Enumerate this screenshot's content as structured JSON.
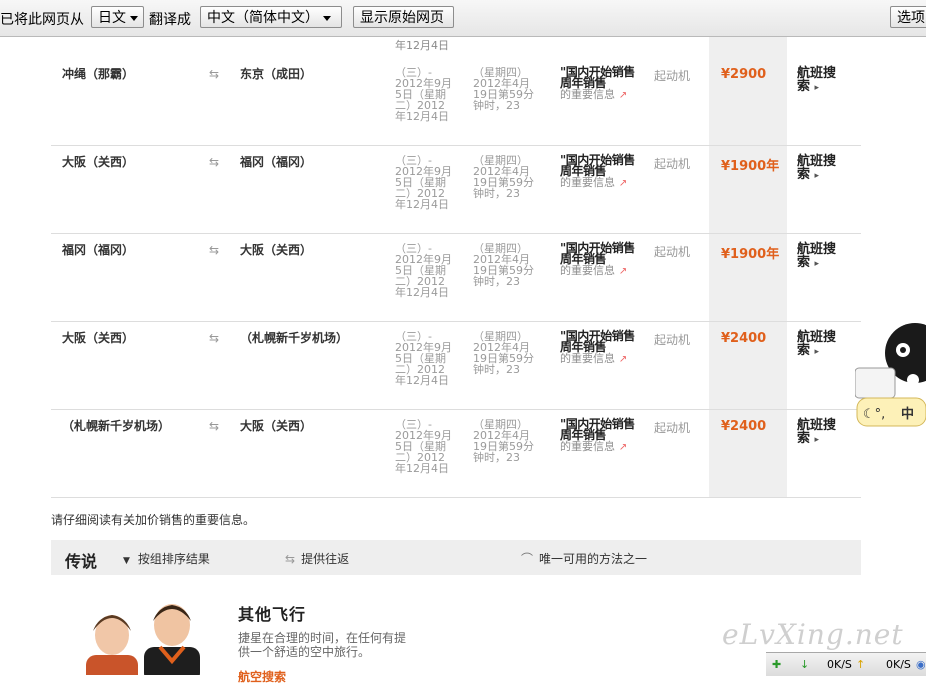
{
  "translate_bar": {
    "prefix": "已将此网页从",
    "source_lang": "日文",
    "translate_to": "翻译成",
    "target_lang": "中文（简体中文）",
    "show_original": "显示原始网页",
    "options": "选项"
  },
  "top_fragment": "年12月4日",
  "flights": [
    {
      "from": "冲绳（那霸）",
      "to": "东京（成田）",
      "date_from": "（三）- 2012年9月5日（星期二）2012年12月4日",
      "date_to": "（星期四）2012年4月19日第59分钟时，23",
      "sale_title": "\"国内开始销售周年销售",
      "sale_info": "的重要信息",
      "engine": "起动机",
      "price": "¥2900",
      "search": "航班搜索"
    },
    {
      "from": "大阪（关西）",
      "to": "福冈（福冈）",
      "date_from": "（三）- 2012年9月5日（星期二）2012年12月4日",
      "date_to": "（星期四）2012年4月19日第59分钟时，23",
      "sale_title": "\"国内开始销售周年销售",
      "sale_info": "的重要信息",
      "engine": "起动机",
      "price": "¥1900年",
      "search": "航班搜索"
    },
    {
      "from": "福冈（福冈）",
      "to": "大阪（关西）",
      "date_from": "（三）- 2012年9月5日（星期二）2012年12月4日",
      "date_to": "（星期四）2012年4月19日第59分钟时，23",
      "sale_title": "\"国内开始销售周年销售",
      "sale_info": "的重要信息",
      "engine": "起动机",
      "price": "¥1900年",
      "search": "航班搜索"
    },
    {
      "from": "大阪（关西）",
      "to": "（札幌新千岁机场）",
      "date_from": "（三）- 2012年9月5日（星期二）2012年12月4日",
      "date_to": "（星期四）2012年4月19日第59分钟时，23",
      "sale_title": "\"国内开始销售周年销售",
      "sale_info": "的重要信息",
      "engine": "起动机",
      "price": "¥2400",
      "search": "航班搜索"
    },
    {
      "from": "（札幌新千岁机场）",
      "to": "大阪（关西）",
      "date_from": "（三）- 2012年9月5日（星期二）2012年12月4日",
      "date_to": "（星期四）2012年4月19日第59分钟时，23",
      "sale_title": "\"国内开始销售周年销售",
      "sale_info": "的重要信息",
      "engine": "起动机",
      "price": "¥2400",
      "search": "航班搜索"
    }
  ],
  "note": "请仔细阅读有关加价销售的重要信息。",
  "legend": {
    "title": "传说",
    "group_sort": "按组排序结果",
    "round_trip": "提供往返",
    "only_method": "唯一可用的方法之一"
  },
  "other_flights": {
    "title": "其他飞行",
    "desc": "捷星在合理的时间，在任何有提供一个舒适的空中旅行。",
    "link": "航空搜索"
  },
  "watermark": "eLvXing.net",
  "mascot_label": "中",
  "status": {
    "down": "0K/S",
    "up": "0K/S"
  },
  "colors": {
    "price": "#e0601c",
    "highlight_column": "#efefef"
  }
}
